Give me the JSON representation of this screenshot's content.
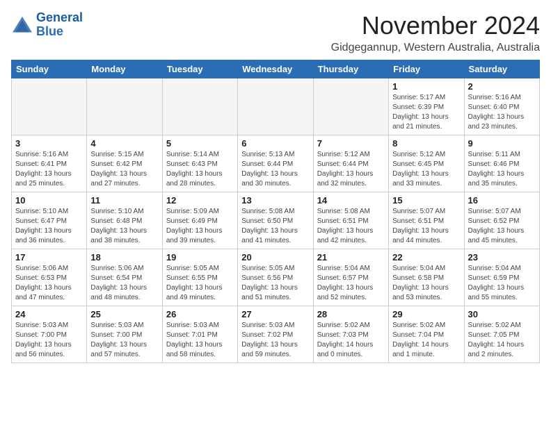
{
  "logo": {
    "line1": "General",
    "line2": "Blue"
  },
  "title": "November 2024",
  "location": "Gidgegannup, Western Australia, Australia",
  "weekdays": [
    "Sunday",
    "Monday",
    "Tuesday",
    "Wednesday",
    "Thursday",
    "Friday",
    "Saturday"
  ],
  "weeks": [
    [
      {
        "day": "",
        "detail": ""
      },
      {
        "day": "",
        "detail": ""
      },
      {
        "day": "",
        "detail": ""
      },
      {
        "day": "",
        "detail": ""
      },
      {
        "day": "",
        "detail": ""
      },
      {
        "day": "1",
        "detail": "Sunrise: 5:17 AM\nSunset: 6:39 PM\nDaylight: 13 hours\nand 21 minutes."
      },
      {
        "day": "2",
        "detail": "Sunrise: 5:16 AM\nSunset: 6:40 PM\nDaylight: 13 hours\nand 23 minutes."
      }
    ],
    [
      {
        "day": "3",
        "detail": "Sunrise: 5:16 AM\nSunset: 6:41 PM\nDaylight: 13 hours\nand 25 minutes."
      },
      {
        "day": "4",
        "detail": "Sunrise: 5:15 AM\nSunset: 6:42 PM\nDaylight: 13 hours\nand 27 minutes."
      },
      {
        "day": "5",
        "detail": "Sunrise: 5:14 AM\nSunset: 6:43 PM\nDaylight: 13 hours\nand 28 minutes."
      },
      {
        "day": "6",
        "detail": "Sunrise: 5:13 AM\nSunset: 6:44 PM\nDaylight: 13 hours\nand 30 minutes."
      },
      {
        "day": "7",
        "detail": "Sunrise: 5:12 AM\nSunset: 6:44 PM\nDaylight: 13 hours\nand 32 minutes."
      },
      {
        "day": "8",
        "detail": "Sunrise: 5:12 AM\nSunset: 6:45 PM\nDaylight: 13 hours\nand 33 minutes."
      },
      {
        "day": "9",
        "detail": "Sunrise: 5:11 AM\nSunset: 6:46 PM\nDaylight: 13 hours\nand 35 minutes."
      }
    ],
    [
      {
        "day": "10",
        "detail": "Sunrise: 5:10 AM\nSunset: 6:47 PM\nDaylight: 13 hours\nand 36 minutes."
      },
      {
        "day": "11",
        "detail": "Sunrise: 5:10 AM\nSunset: 6:48 PM\nDaylight: 13 hours\nand 38 minutes."
      },
      {
        "day": "12",
        "detail": "Sunrise: 5:09 AM\nSunset: 6:49 PM\nDaylight: 13 hours\nand 39 minutes."
      },
      {
        "day": "13",
        "detail": "Sunrise: 5:08 AM\nSunset: 6:50 PM\nDaylight: 13 hours\nand 41 minutes."
      },
      {
        "day": "14",
        "detail": "Sunrise: 5:08 AM\nSunset: 6:51 PM\nDaylight: 13 hours\nand 42 minutes."
      },
      {
        "day": "15",
        "detail": "Sunrise: 5:07 AM\nSunset: 6:51 PM\nDaylight: 13 hours\nand 44 minutes."
      },
      {
        "day": "16",
        "detail": "Sunrise: 5:07 AM\nSunset: 6:52 PM\nDaylight: 13 hours\nand 45 minutes."
      }
    ],
    [
      {
        "day": "17",
        "detail": "Sunrise: 5:06 AM\nSunset: 6:53 PM\nDaylight: 13 hours\nand 47 minutes."
      },
      {
        "day": "18",
        "detail": "Sunrise: 5:06 AM\nSunset: 6:54 PM\nDaylight: 13 hours\nand 48 minutes."
      },
      {
        "day": "19",
        "detail": "Sunrise: 5:05 AM\nSunset: 6:55 PM\nDaylight: 13 hours\nand 49 minutes."
      },
      {
        "day": "20",
        "detail": "Sunrise: 5:05 AM\nSunset: 6:56 PM\nDaylight: 13 hours\nand 51 minutes."
      },
      {
        "day": "21",
        "detail": "Sunrise: 5:04 AM\nSunset: 6:57 PM\nDaylight: 13 hours\nand 52 minutes."
      },
      {
        "day": "22",
        "detail": "Sunrise: 5:04 AM\nSunset: 6:58 PM\nDaylight: 13 hours\nand 53 minutes."
      },
      {
        "day": "23",
        "detail": "Sunrise: 5:04 AM\nSunset: 6:59 PM\nDaylight: 13 hours\nand 55 minutes."
      }
    ],
    [
      {
        "day": "24",
        "detail": "Sunrise: 5:03 AM\nSunset: 7:00 PM\nDaylight: 13 hours\nand 56 minutes."
      },
      {
        "day": "25",
        "detail": "Sunrise: 5:03 AM\nSunset: 7:00 PM\nDaylight: 13 hours\nand 57 minutes."
      },
      {
        "day": "26",
        "detail": "Sunrise: 5:03 AM\nSunset: 7:01 PM\nDaylight: 13 hours\nand 58 minutes."
      },
      {
        "day": "27",
        "detail": "Sunrise: 5:03 AM\nSunset: 7:02 PM\nDaylight: 13 hours\nand 59 minutes."
      },
      {
        "day": "28",
        "detail": "Sunrise: 5:02 AM\nSunset: 7:03 PM\nDaylight: 14 hours\nand 0 minutes."
      },
      {
        "day": "29",
        "detail": "Sunrise: 5:02 AM\nSunset: 7:04 PM\nDaylight: 14 hours\nand 1 minute."
      },
      {
        "day": "30",
        "detail": "Sunrise: 5:02 AM\nSunset: 7:05 PM\nDaylight: 14 hours\nand 2 minutes."
      }
    ]
  ]
}
